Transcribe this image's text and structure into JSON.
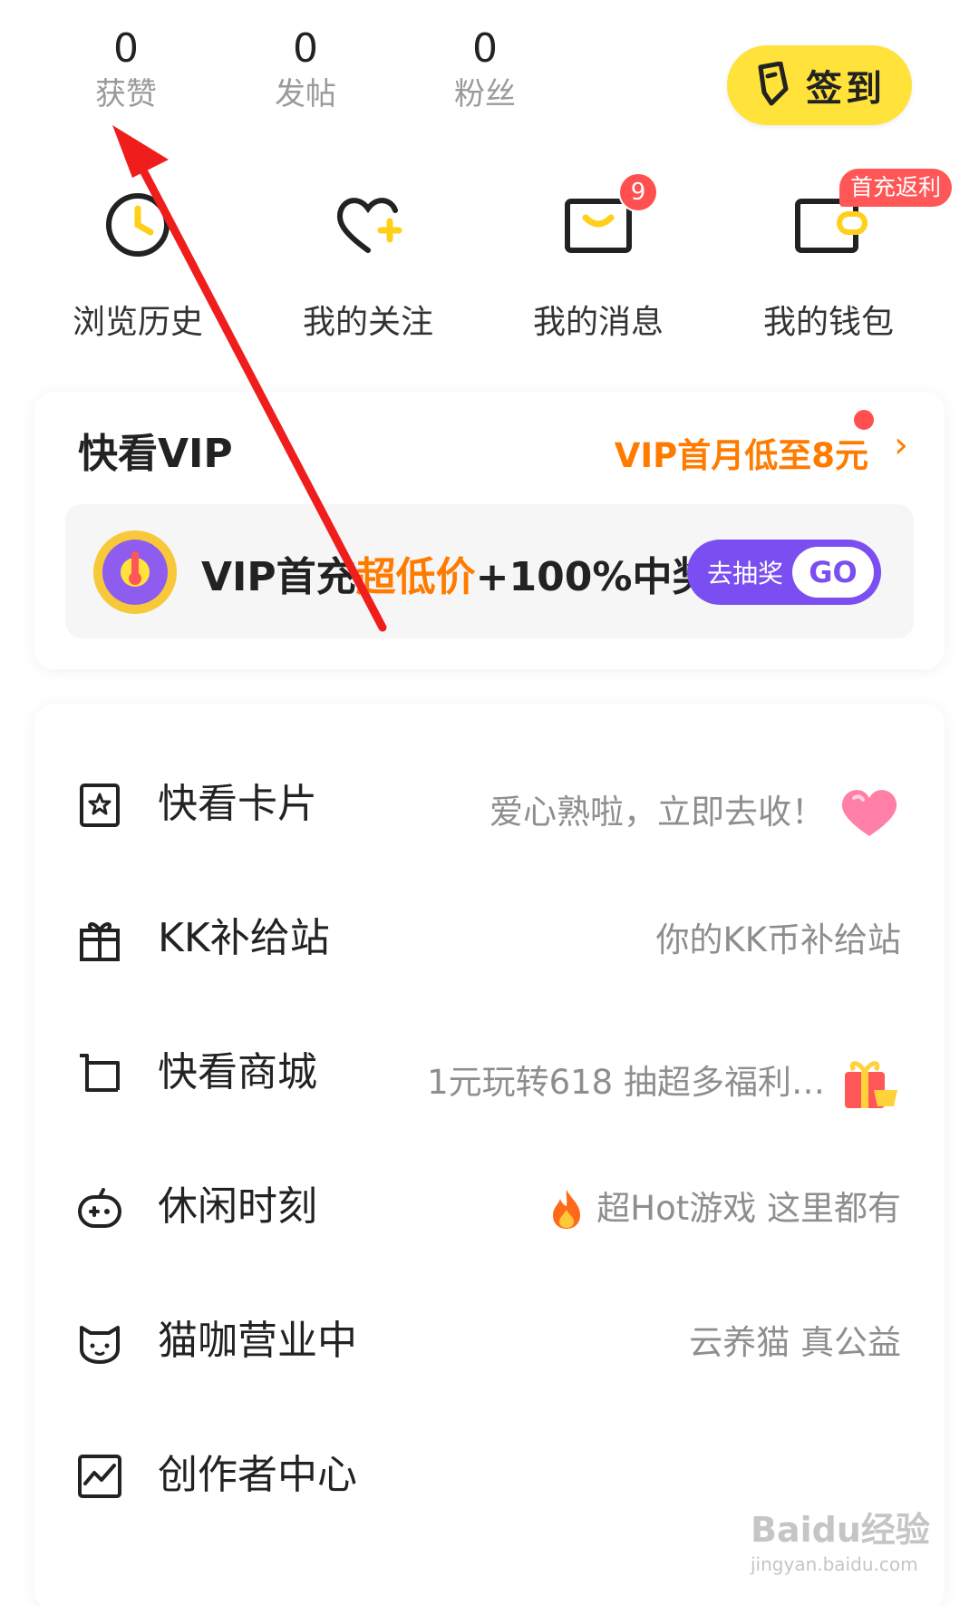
{
  "stats": [
    {
      "value": "0",
      "label": "获赞"
    },
    {
      "value": "0",
      "label": "发帖"
    },
    {
      "value": "0",
      "label": "粉丝"
    }
  ],
  "checkin": {
    "label": "签到",
    "icon": "sign-in-icon"
  },
  "quick_entries": [
    {
      "label": "浏览历史",
      "icon": "history-clock-icon"
    },
    {
      "label": "我的关注",
      "icon": "heart-plus-icon"
    },
    {
      "label": "我的消息",
      "icon": "message-box-icon",
      "badge": "9"
    },
    {
      "label": "我的钱包",
      "icon": "wallet-icon",
      "promo": "首充返利"
    }
  ],
  "vip": {
    "title": "快看VIP",
    "promo": "VIP首月低至8元",
    "chevron": "›",
    "banner": {
      "text_1": "VIP首充",
      "text_highlight": "超低价",
      "text_2": "+100%中奖",
      "button_label": "去抽奖",
      "button_go": "GO",
      "highlight_color": "#ff7b00",
      "button_color": "#7a4ef0"
    }
  },
  "menu": [
    {
      "title": "快看卡片",
      "subtitle": "爱心熟啦，立即去收！",
      "icon": "card-star-icon",
      "trailing": "heart-icon"
    },
    {
      "title": "KK补给站",
      "subtitle": "你的KK币补给站",
      "icon": "gift-box-icon",
      "trailing": ""
    },
    {
      "title": "快看商城",
      "subtitle": "1元玩转618 抽超多福利…",
      "icon": "shopping-cart-icon",
      "trailing": "gift-icon"
    },
    {
      "title": "休闲时刻",
      "subtitle": "超Hot游戏 这里都有",
      "icon": "game-controller-icon",
      "leading": "fire-icon"
    },
    {
      "title": "猫咖营业中",
      "subtitle": "云养猫 真公益",
      "icon": "cat-icon",
      "trailing": ""
    },
    {
      "title": "创作者中心",
      "subtitle": "",
      "icon": "chart-line-icon",
      "trailing": ""
    }
  ],
  "watermark": {
    "logo": "Baidu经验",
    "url": "jingyan.baidu.com"
  },
  "colors": {
    "accent_yellow": "#ffe23a",
    "accent_orange": "#ff7b00",
    "badge_red": "#ff4f4f",
    "arrow_red": "#f01d1d"
  }
}
